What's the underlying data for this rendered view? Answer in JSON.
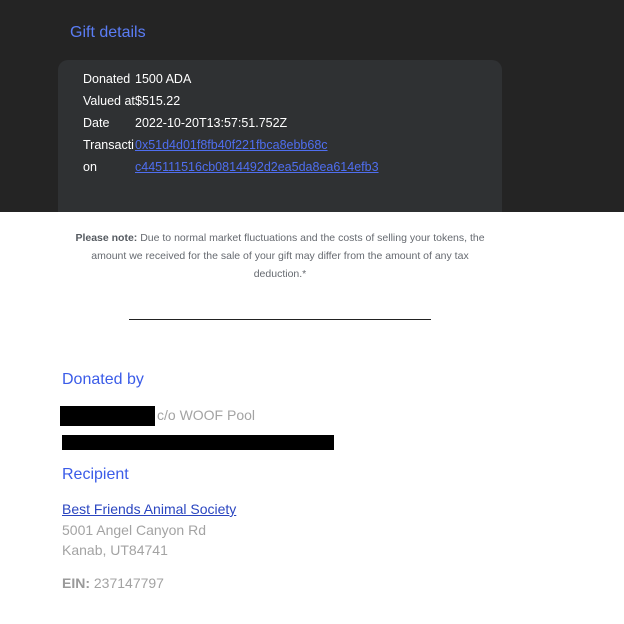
{
  "gift": {
    "title": "Gift details",
    "rows": {
      "donated": {
        "label": "Donated",
        "value": "1500 ADA"
      },
      "valued": {
        "label": "Valued at",
        "value": "$515.22"
      },
      "date": {
        "label": "Date",
        "value": "2022-10-20T13:57:51.752Z"
      },
      "transaction": {
        "label": "Transaction",
        "line1": "0x51d4d01f8fb40f221fbca8ebb68c",
        "line2": "c445111516cb0814492d2ea5da8ea614efb3"
      }
    }
  },
  "note": {
    "label": "Please note:",
    "text": " Due to normal market fluctuations and the costs of selling your tokens, the amount we received for the sale of your gift may differ from the amount of any tax deduction.*"
  },
  "donor": {
    "title": "Donated by",
    "co_text": "c/o WOOF Pool"
  },
  "recipient": {
    "title": "Recipient",
    "name": "Best Friends Animal Society",
    "address1": "5001 Angel Canyon Rd",
    "address2": "Kanab, UT84741",
    "ein_label": "EIN:",
    "ein_value": "237147797"
  }
}
